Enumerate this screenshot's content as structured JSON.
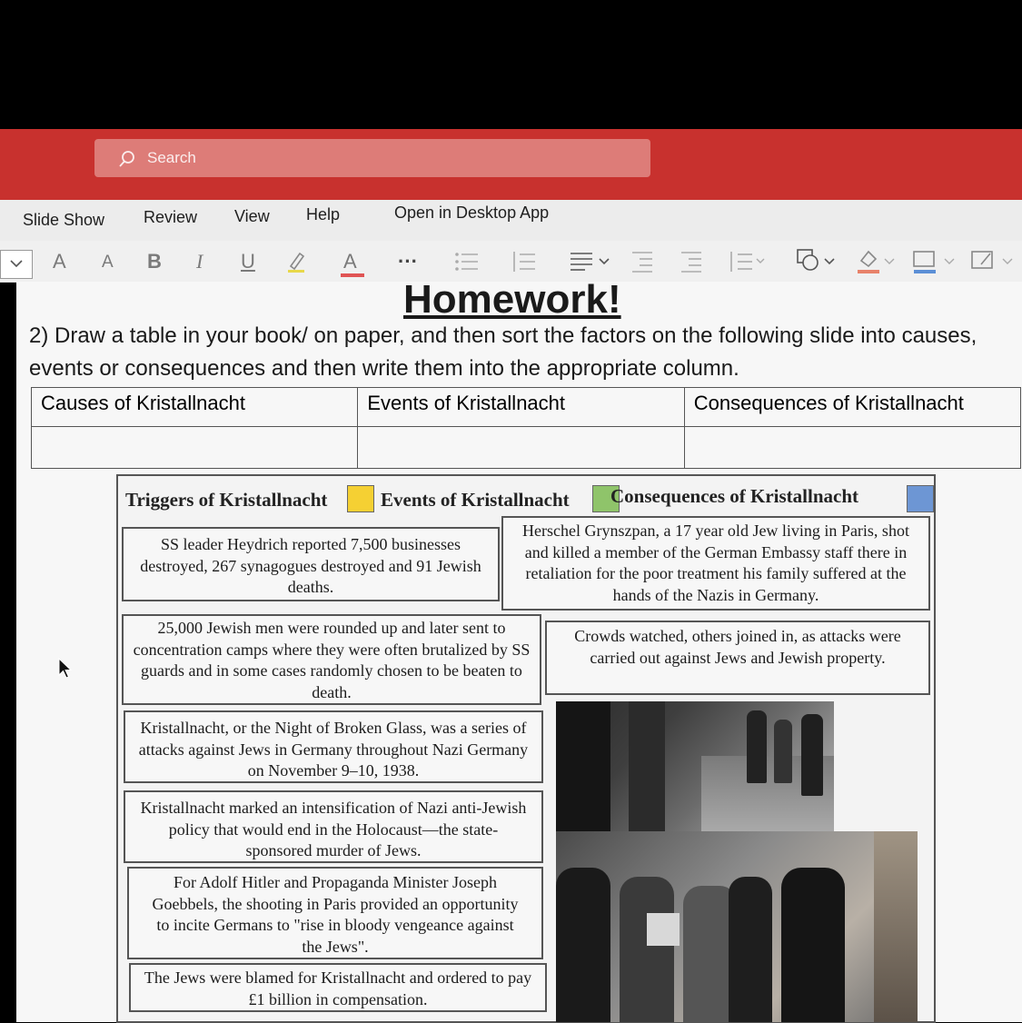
{
  "app": {
    "search_placeholder": "Search"
  },
  "menu": {
    "slide_show": "Slide Show",
    "review": "Review",
    "view": "View",
    "help": "Help",
    "open_desktop": "Open in Desktop App"
  },
  "toolbar": {
    "grow_font": "A",
    "shrink_font": "A",
    "bold": "B",
    "italic": "I",
    "underline": "U",
    "font_color": "A",
    "more": "···"
  },
  "slide": {
    "title": "Homework!",
    "instruction": "2) Draw a table in your book/ on paper, and then sort the factors on the following slide into causes, events or consequences and then write them into the appropriate column.",
    "table_headers": [
      "Causes of Kristallnacht",
      "Events of Kristallnacht",
      "Consequences of Kristallnacht"
    ],
    "legend": [
      {
        "label": "Triggers of Kristallnacht",
        "color": "#f5d033"
      },
      {
        "label": "Events of Kristallnacht",
        "color": "#8fc46a"
      },
      {
        "label": "Consequences of Kristallnacht",
        "color": "#6d96d4"
      }
    ],
    "cards": [
      "SS leader Heydrich reported 7,500 businesses destroyed, 267 synagogues destroyed and 91 Jewish deaths.",
      "Herschel Grynszpan, a 17 year old Jew living in Paris, shot and killed a member of the German Embassy staff there in retaliation for the poor treatment his family suffered at the hands of the Nazis in Germany.",
      "25,000 Jewish men were rounded up and later sent to concentration camps where they were often brutalized by SS guards and in some cases randomly chosen to be beaten to death.",
      "Crowds watched, others joined in, as attacks were carried out against Jews and Jewish property.",
      "Kristallnacht, or the Night of Broken Glass, was a series of attacks against Jews in Germany throughout Nazi Germany on November 9–10, 1938.",
      "Kristallnacht marked an intensification of Nazi anti-Jewish policy that would end in the Holocaust—the state-sponsored murder of Jews.",
      "For Adolf Hitler and Propaganda Minister Joseph Goebbels, the shooting in Paris provided an opportunity to incite Germans to \"rise in bloody vengeance against the Jews\".",
      "The Jews were blamed for Kristallnacht and ordered to pay £1 billion in compensation."
    ]
  }
}
